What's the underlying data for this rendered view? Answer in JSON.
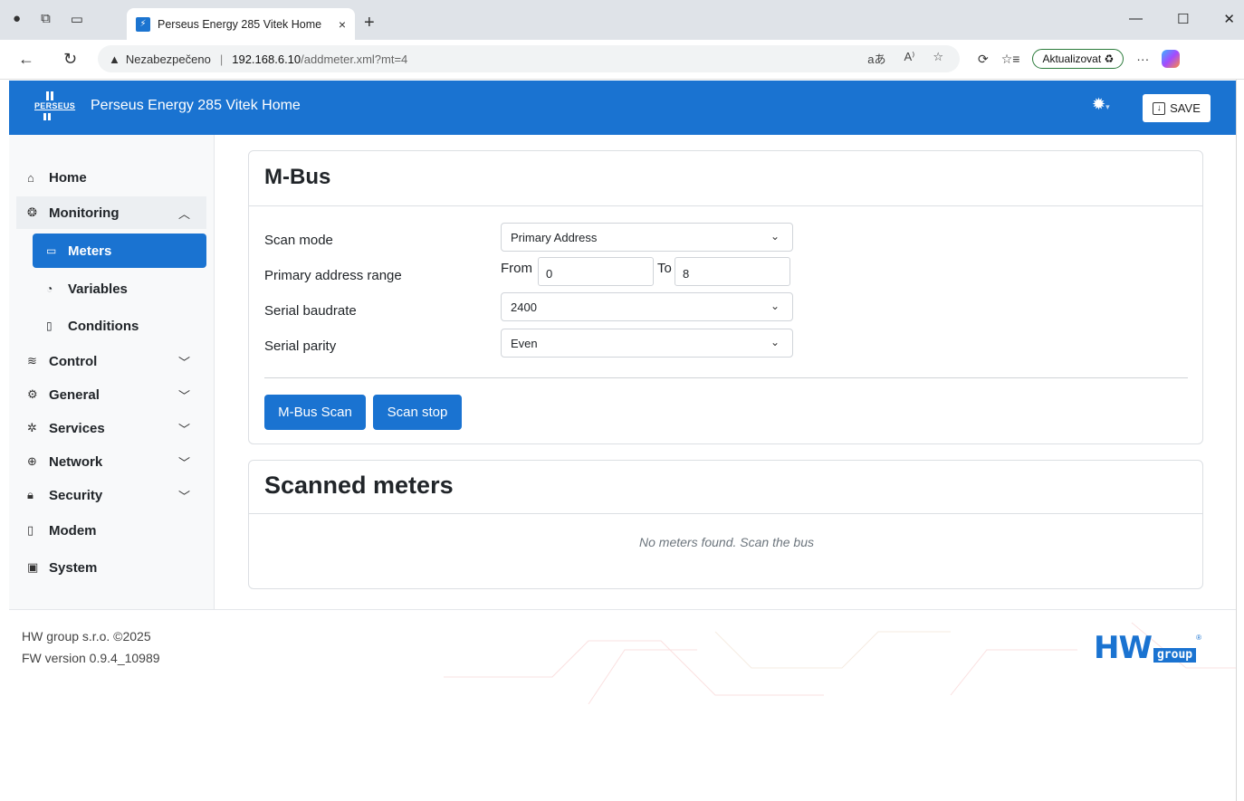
{
  "browser": {
    "tab_title": "Perseus Energy 285 Vitek Home",
    "tab_close": "×",
    "new_tab": "+",
    "insecure_label": "Nezabezpečeno",
    "url_host": "192.168.6.10",
    "url_path": "/addmeter.xml?mt=4",
    "update_label": "Aktualizovat",
    "more": "···"
  },
  "header": {
    "logo_text": "PERSEUS",
    "title": "Perseus Energy 285 Vitek Home",
    "save_label": "SAVE"
  },
  "sidebar": {
    "home": "Home",
    "monitoring": "Monitoring",
    "meters": "Meters",
    "variables": "Variables",
    "conditions": "Conditions",
    "control": "Control",
    "general": "General",
    "services": "Services",
    "network": "Network",
    "security": "Security",
    "modem": "Modem",
    "system": "System"
  },
  "mbus": {
    "title": "M-Bus",
    "scan_mode_label": "Scan mode",
    "scan_mode_value": "Primary Address",
    "range_label": "Primary address range",
    "from_label": "From",
    "from_value": "0",
    "to_label": "To",
    "to_value": "8",
    "baudrate_label": "Serial baudrate",
    "baudrate_value": "2400",
    "parity_label": "Serial parity",
    "parity_value": "Even",
    "scan_button": "M-Bus Scan",
    "stop_button": "Scan stop"
  },
  "scanned": {
    "title": "Scanned meters",
    "empty_message": "No meters found. Scan the bus"
  },
  "footer": {
    "company": "HW group s.r.o. ©2025",
    "fw_version": "FW version 0.9.4_10989",
    "logo_hw": "HW",
    "logo_group": "group",
    "logo_reg": "®"
  },
  "colors": {
    "primary": "#1a73d1",
    "sidebar_bg": "#f8f9fa"
  }
}
